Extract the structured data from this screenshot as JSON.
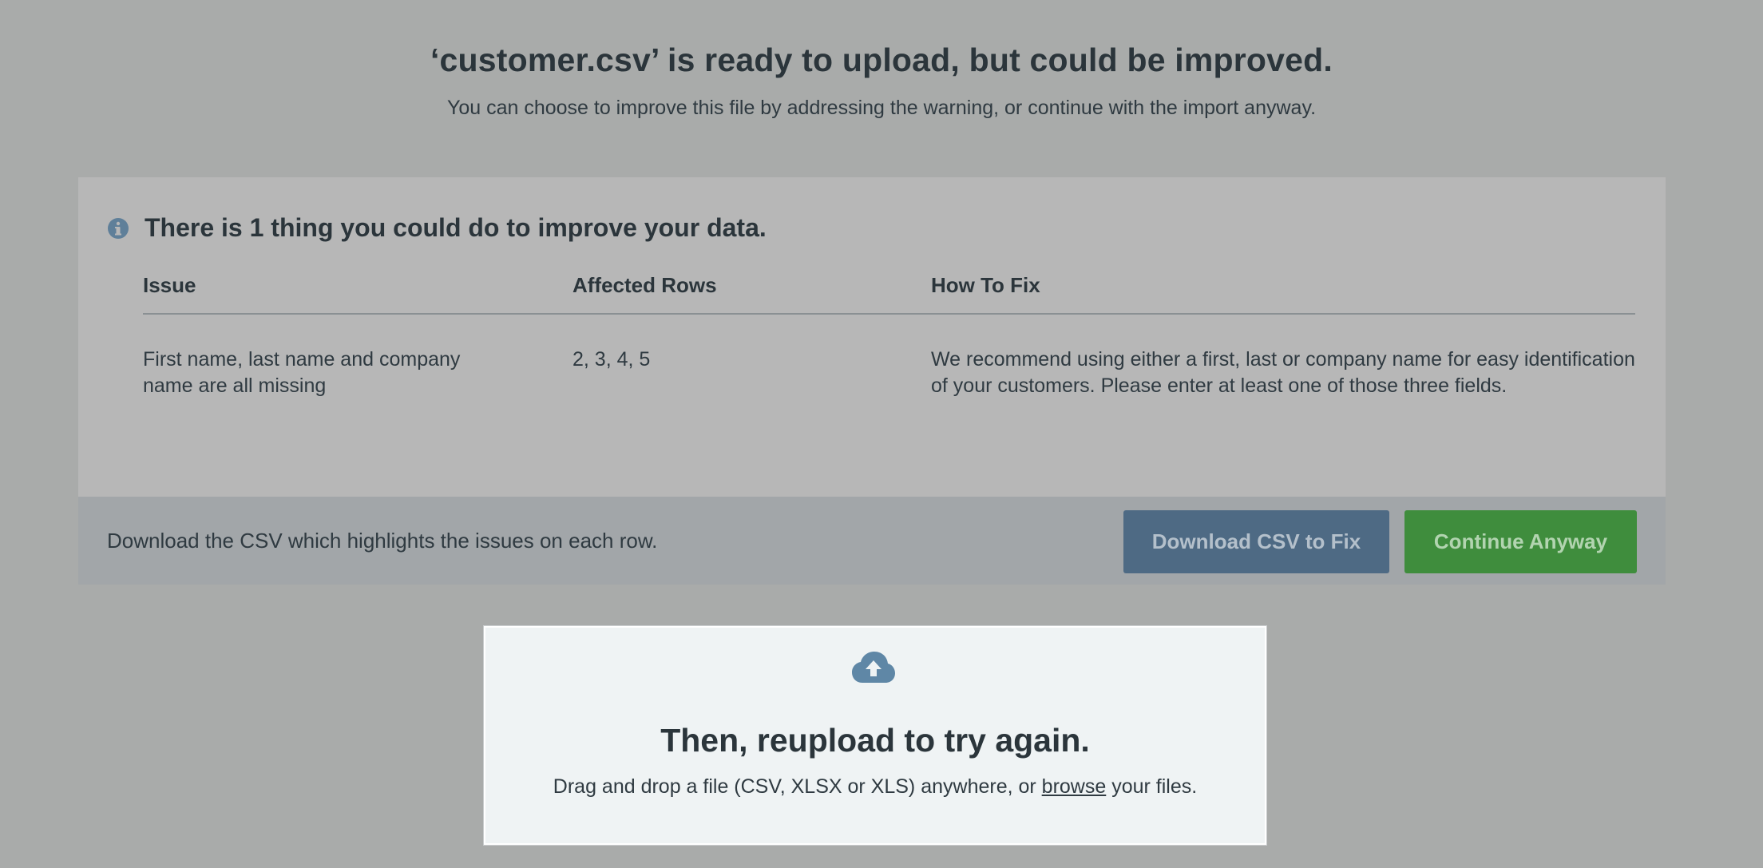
{
  "header": {
    "title": "‘customer.csv’ is ready to upload, but could be improved.",
    "subtitle": "You can choose to improve this file by addressing the warning, or continue with the import anyway."
  },
  "issues_panel": {
    "heading": "There is 1 thing you could do to improve your data.",
    "icon": "info-icon",
    "columns": [
      "Issue",
      "Affected Rows",
      "How To Fix"
    ],
    "rows": [
      {
        "issue": "First name, last name and company name are all missing",
        "affected_rows": "2, 3, 4, 5",
        "how_to_fix": "We recommend using either a first, last or company name for easy identification of your customers. Please enter at least one of those three fields."
      }
    ],
    "footer_text": "Download the CSV which highlights the issues on each row.",
    "download_button": "Download CSV to Fix",
    "continue_button": "Continue Anyway"
  },
  "upload": {
    "icon": "cloud-upload-icon",
    "title": "Then, reupload to try again.",
    "text_before": "Drag and drop a file (CSV, XLSX or XLS) anywhere, or ",
    "browse_label": "browse",
    "text_after": " your files."
  },
  "colors": {
    "background": "#a9abaa",
    "panel": "#b7b7b7",
    "footer": "#a2a6a9",
    "download_button": "#4e6a84",
    "continue_button": "#3f8d3d",
    "icon_accent": "#5f87a6"
  }
}
